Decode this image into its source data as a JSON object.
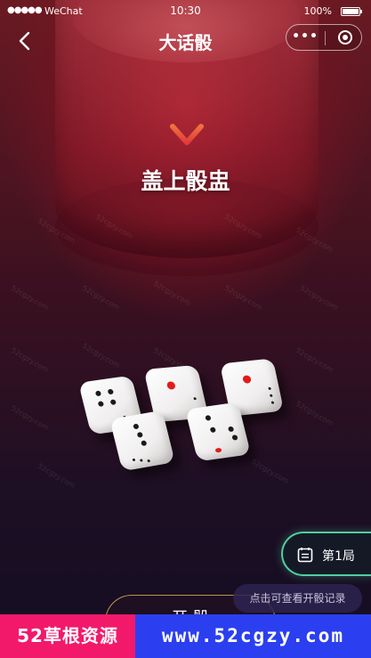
{
  "status_bar": {
    "signal": "●●●●●",
    "carrier": "WeChat",
    "time": "10:30",
    "battery": "100%",
    "battery_level": 1.0
  },
  "nav": {
    "back_icon": "chevron-left-icon",
    "title": "大话骰",
    "more_icon": "•••",
    "close_icon": "target-circle-icon"
  },
  "game": {
    "instruction": "盖上骰盅",
    "dice_faces": [
      4,
      1,
      5,
      1,
      5
    ]
  },
  "round_badge": {
    "icon": "calendar-icon",
    "label": "第1局",
    "accent": "#4fcfa0"
  },
  "tip": {
    "text": "点击可查看开骰记录"
  },
  "action_button": {
    "label": "开 骰"
  },
  "watermark": {
    "text": "52cgzy.com"
  },
  "banner": {
    "left_text": "52草根资源",
    "right_text": "www.52cgzy.com",
    "left_color": "#f2196b",
    "right_color": "#2b3ff0"
  },
  "colors": {
    "background": "#1b0d1f",
    "cup_red": "#b8283a",
    "arrow": "#e8503c",
    "pip_red": "#e11b1b"
  }
}
